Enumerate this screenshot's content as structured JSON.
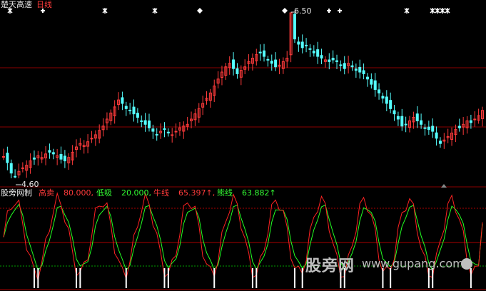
{
  "header": {
    "title": "楚天高速",
    "period": "日线"
  },
  "indicator": {
    "name": "股旁网制",
    "items": [
      {
        "label": "高卖",
        "value": "80.000,",
        "color": "#ff3b3b"
      },
      {
        "label": "低吸",
        "value": "20.000,",
        "color": "#33ff33"
      },
      {
        "label": "牛线",
        "value": "65.397↑,",
        "color": "#ff3b3b"
      },
      {
        "label": "熊线",
        "value": "63.882↑",
        "color": "#33ff33"
      }
    ]
  },
  "watermark": {
    "brand": "股旁网",
    "url": "www.gupang.com"
  },
  "colors": {
    "up": "#ff3b3b",
    "down": "#55ffff",
    "grid": "#8b0000",
    "bull": "#ff2222",
    "bear": "#22ff22"
  },
  "chart_data": [
    {
      "type": "candlestick",
      "title": "楚天高速 日线",
      "annotations": {
        "high": "6.50",
        "low": "4.60"
      },
      "closes": [
        4.85,
        4.78,
        4.66,
        4.62,
        4.68,
        4.72,
        4.75,
        4.8,
        4.82,
        4.86,
        4.84,
        4.88,
        4.9,
        4.88,
        4.86,
        4.82,
        4.8,
        4.84,
        4.9,
        4.96,
        5.0,
        4.98,
        5.02,
        5.06,
        5.1,
        5.15,
        5.2,
        5.28,
        5.35,
        5.42,
        5.5,
        5.46,
        5.4,
        5.38,
        5.34,
        5.3,
        5.26,
        5.22,
        5.18,
        5.14,
        5.1,
        5.14,
        5.16,
        5.12,
        5.1,
        5.14,
        5.18,
        5.2,
        5.22,
        5.28,
        5.34,
        5.4,
        5.46,
        5.52,
        5.58,
        5.66,
        5.74,
        5.82,
        5.88,
        5.92,
        5.86,
        5.8,
        5.84,
        5.88,
        5.94,
        5.98,
        6.02,
        6.04,
        6.0,
        5.96,
        5.92,
        5.88,
        5.9,
        5.94,
        5.98,
        6.5,
        6.2,
        6.14,
        6.1,
        6.12,
        6.08,
        6.04,
        6.0,
        5.98,
        5.96,
        5.94,
        5.96,
        5.94,
        5.9,
        5.86,
        5.92,
        5.88,
        5.84,
        5.82,
        5.8,
        5.74,
        5.68,
        5.62,
        5.58,
        5.52,
        5.46,
        5.4,
        5.34,
        5.28,
        5.2,
        5.22,
        5.26,
        5.3,
        5.26,
        5.22,
        5.18,
        5.16,
        5.14,
        5.06,
        5.0,
        5.04,
        5.08,
        5.12,
        5.16,
        5.18,
        5.22,
        5.26,
        5.24,
        5.28,
        5.32,
        5.38
      ],
      "bull_line_last": 65.397,
      "bear_line_last": 63.882,
      "sell_level": 80.0,
      "buy_level": 20.0
    }
  ]
}
